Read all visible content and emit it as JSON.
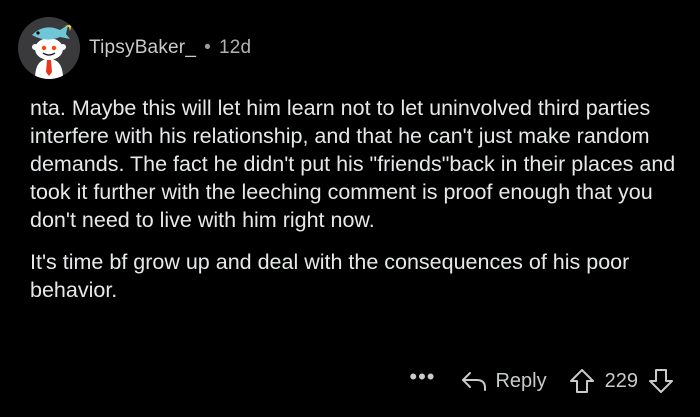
{
  "comment": {
    "author": "TipsyBaker_",
    "separator": "•",
    "age": "12d",
    "avatar_icon": "snoo-avatar-icon",
    "paragraphs": [
      "nta. Maybe this will let him learn not to let uninvolved third parties interfere with his relationship, and that he can't just make random demands. The fact he didn't put his \"friends\"back in their places and took it further with the leeching comment is proof enough that you don't need to live with him right now.",
      "It's time bf grow up and deal with the consequences of his poor behavior."
    ]
  },
  "actions": {
    "more_label": "•••",
    "reply_label": "Reply",
    "vote_count": "229",
    "icons": {
      "reply": "reply-arrow-icon",
      "upvote": "upvote-arrow-icon",
      "downvote": "downvote-arrow-icon"
    }
  },
  "colors": {
    "background": "#000000",
    "text": "#e6e8ea",
    "meta": "#c8cacc"
  }
}
